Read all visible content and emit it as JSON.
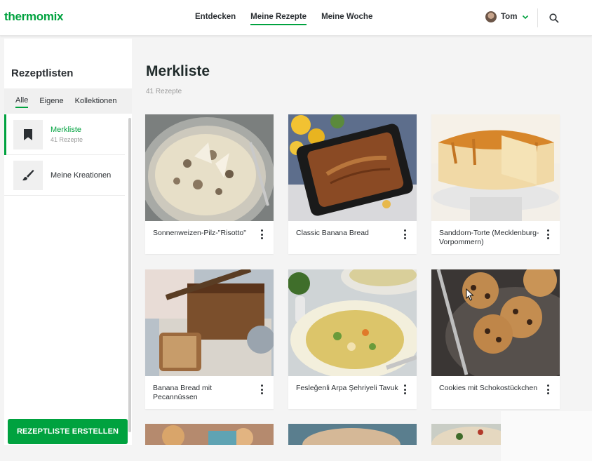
{
  "header": {
    "logo": "thermomix",
    "nav": [
      "Entdecken",
      "Meine Rezepte",
      "Meine Woche"
    ],
    "active_nav": "Meine Rezepte",
    "user_name": "Tom"
  },
  "sidebar": {
    "title": "Rezeptlisten",
    "tabs": [
      "Alle",
      "Eigene",
      "Kollektionen"
    ],
    "items": [
      {
        "label": "Merkliste",
        "sub": "41 Rezepte",
        "icon": "bookmark-icon"
      },
      {
        "label": "Meine Kreationen",
        "sub": "",
        "icon": "brush-icon"
      }
    ],
    "create_label": "REZEPTLISTE ERSTELLEN"
  },
  "main": {
    "title": "Merkliste",
    "count": "41 Rezepte",
    "recipes": [
      {
        "title": "Sonnenweizen-Pilz-\"Risotto\""
      },
      {
        "title": "Classic Banana Bread"
      },
      {
        "title": "Sanddorn-Torte (Mecklenburg-Vorpommern)"
      },
      {
        "title": "Banana Bread mit Pecannüssen"
      },
      {
        "title": "Fesleğenli Arpa Şehriyeli Tavuk"
      },
      {
        "title": "Cookies mit Schokostückchen"
      }
    ]
  },
  "colors": {
    "accent": "#00a23f",
    "text": "#2b2f33",
    "background": "#f4f4f4"
  }
}
